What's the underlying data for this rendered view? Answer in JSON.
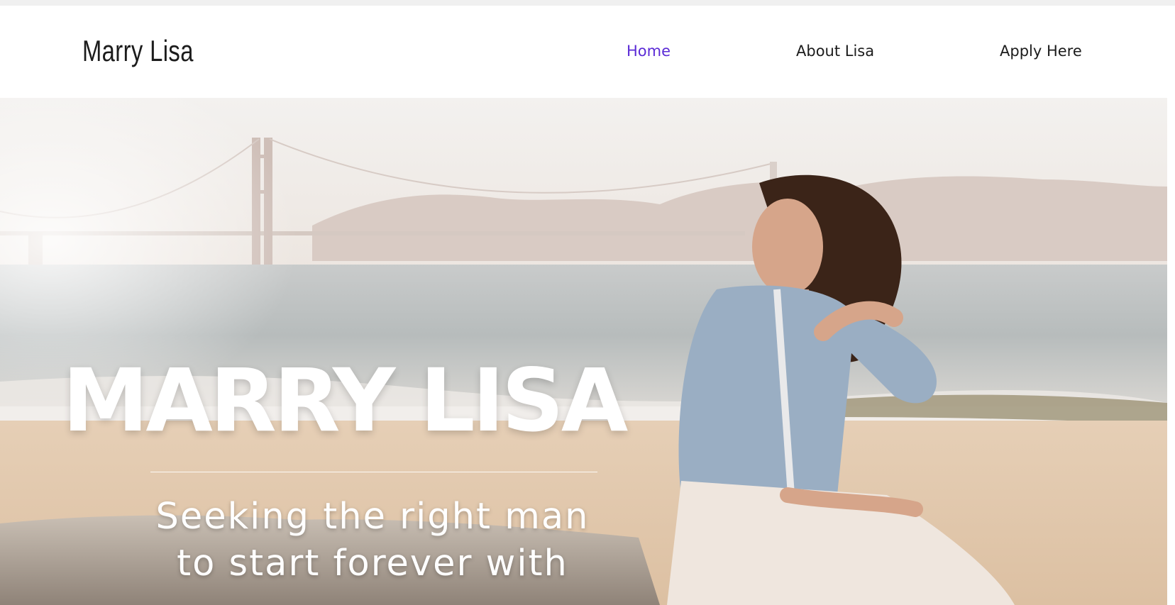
{
  "site": {
    "logo": "Marry Lisa"
  },
  "nav": {
    "items": [
      {
        "label": "Home",
        "active": true
      },
      {
        "label": "About Lisa",
        "active": false
      },
      {
        "label": "Apply Here",
        "active": false
      }
    ],
    "active_color": "#5b2bd6",
    "default_color": "#1c1c1c"
  },
  "hero": {
    "title": "MARRY LISA",
    "subtitle_line1": "Seeking the right man",
    "subtitle_line2": "to start forever with",
    "image_icon": "beach-portrait-photo"
  }
}
